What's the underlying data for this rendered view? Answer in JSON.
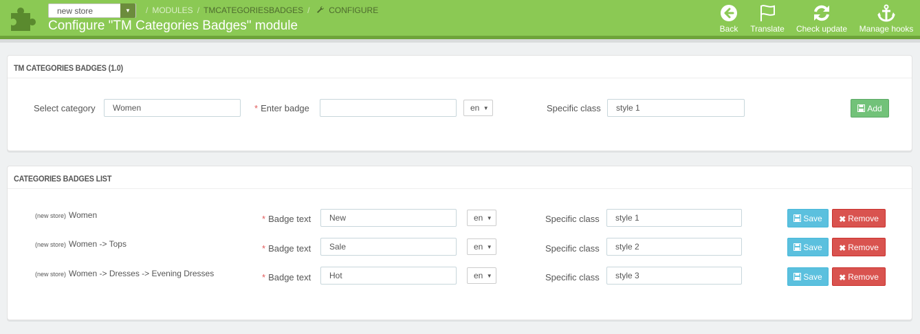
{
  "header": {
    "store_select": "new store",
    "breadcrumb": [
      "MODULES",
      "TMCATEGORIESBADGES",
      "CONFIGURE"
    ],
    "title": "Configure \"TM Categories Badges\" module",
    "toolbar": {
      "back": "Back",
      "translate": "Translate",
      "check_update": "Check update",
      "manage_hooks": "Manage hooks"
    }
  },
  "add_panel": {
    "heading": "TM CATEGORIES BADGES (1.0)",
    "select_category_label": "Select category",
    "select_category_value": "Women",
    "enter_badge_label": "Enter badge",
    "enter_badge_value": "",
    "lang": "en",
    "specific_class_label": "Specific class",
    "specific_class_value": "style 1",
    "add_button": "Add"
  },
  "list_panel": {
    "heading": "CATEGORIES BADGES LIST",
    "badge_text_label": "Badge text",
    "specific_class_label": "Specific class",
    "save_button": "Save",
    "remove_button": "Remove",
    "rows": [
      {
        "store": "(new store)",
        "category": "Women",
        "badge": "New",
        "lang": "en",
        "class": "style 1"
      },
      {
        "store": "(new store)",
        "category": "Women -> Tops",
        "badge": "Sale",
        "lang": "en",
        "class": "style 2"
      },
      {
        "store": "(new store)",
        "category": "Women -> Dresses -> Evening Dresses",
        "badge": "Hot",
        "lang": "en",
        "class": "style 3"
      }
    ]
  },
  "colors": {
    "header_green": "#8bc954",
    "add_green": "#72c279",
    "save_blue": "#5bc0de",
    "remove_red": "#d9534f",
    "required_red": "#e15b5b"
  }
}
